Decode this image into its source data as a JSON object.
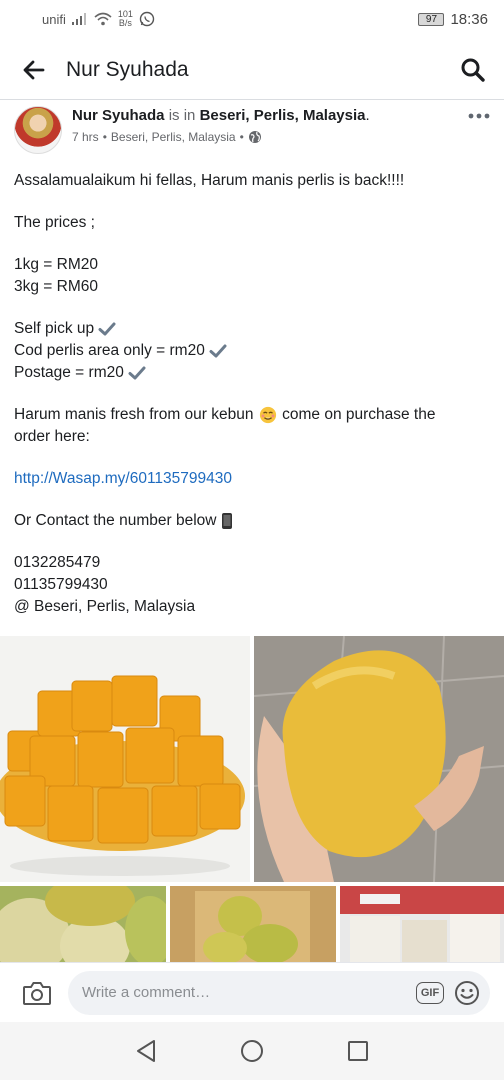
{
  "status_bar": {
    "carrier": "unifi",
    "speed_value": "101",
    "speed_unit": "B/s",
    "battery": "97",
    "time": "18:36"
  },
  "app_bar": {
    "title": "Nur Syuhada"
  },
  "post": {
    "author": "Nur Syuhada",
    "is_in": "is in",
    "location": "Beseri, Perlis, Malaysia",
    "location_suffix": ".",
    "time_ago": "7 hrs",
    "meta_location": "Beseri, Perlis, Malaysia",
    "lines": {
      "l1": "Assalamualaikum hi fellas, Harum manis perlis is back!!!!",
      "l2": "The prices ;",
      "l3": "1kg = RM20",
      "l4": "3kg = RM60",
      "l5": "Self pick up",
      "l6": "Cod perlis area only = rm20",
      "l7": "Postage = rm20",
      "l8a": "Harum manis fresh from our kebun",
      "l8b": "come on purchase the",
      "l9": "order here:",
      "l10": "http://Wasap.my/601135799430",
      "l11": "Or Contact the number below",
      "l12": "0132285479",
      "l13": "01135799430",
      "l14": " @ Beseri, Perlis, Malaysia"
    }
  },
  "comment_bar": {
    "placeholder": "Write a comment…",
    "gif_label": "GIF"
  },
  "icons": {
    "back": "arrow-left-icon",
    "search": "search-icon",
    "more": "more-horizontal-icon",
    "globe": "globe-icon",
    "camera": "camera-icon",
    "emoji": "emoji-icon"
  },
  "colors": {
    "link": "#1e6bbf",
    "text": "#1c1e21",
    "muted": "#65676b"
  }
}
